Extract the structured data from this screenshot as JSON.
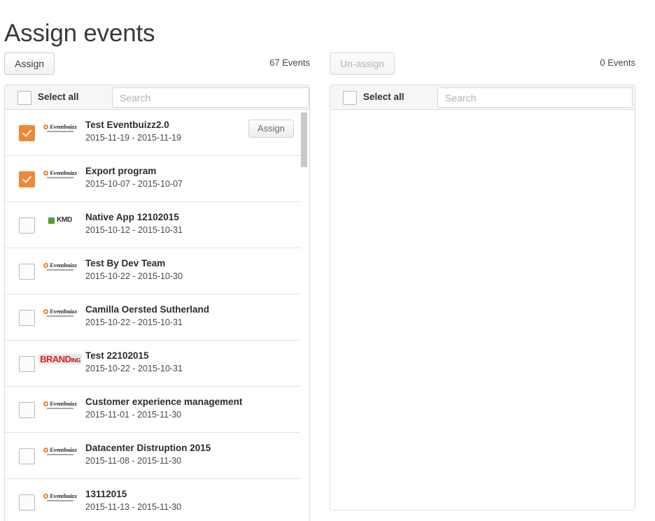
{
  "page": {
    "title": "Assign events"
  },
  "left_panel": {
    "action_button": "Assign",
    "action_disabled": false,
    "count_label": "67 Events",
    "select_all_label": "Select all",
    "search_placeholder": "Search",
    "search_value": "",
    "rows": [
      {
        "checked": true,
        "logo": "eventbuizz-logo",
        "title": "Test Eventbuizz2.0",
        "dates": "2015-11-19 - 2015-11-19",
        "action": "Assign",
        "show_action": true
      },
      {
        "checked": true,
        "logo": "eventbuizz-logo",
        "title": "Export program",
        "dates": "2015-10-07 - 2015-10-07",
        "action": "Assign",
        "show_action": false
      },
      {
        "checked": false,
        "logo": "kmd-logo",
        "title": "Native App 12102015",
        "dates": "2015-10-12 - 2015-10-31",
        "action": "Assign",
        "show_action": false
      },
      {
        "checked": false,
        "logo": "eventbuizz-logo",
        "title": "Test By Dev Team",
        "dates": "2015-10-22 - 2015-10-30",
        "action": "Assign",
        "show_action": false
      },
      {
        "checked": false,
        "logo": "eventbuizz-logo",
        "title": "Camilla Oersted Sutherland",
        "dates": "2015-10-22 - 2015-10-31",
        "action": "Assign",
        "show_action": false
      },
      {
        "checked": false,
        "logo": "branding-logo",
        "title": "Test 22102015",
        "dates": "2015-10-22 - 2015-10-31",
        "action": "Assign",
        "show_action": false
      },
      {
        "checked": false,
        "logo": "eventbuizz-logo",
        "title": "Customer experience management",
        "dates": "2015-11-01 - 2015-11-30",
        "action": "Assign",
        "show_action": false
      },
      {
        "checked": false,
        "logo": "eventbuizz-logo",
        "title": "Datacenter Distruption 2015",
        "dates": "2015-11-08 - 2015-11-30",
        "action": "Assign",
        "show_action": false
      },
      {
        "checked": false,
        "logo": "eventbuizz-logo",
        "title": "13112015",
        "dates": "2015-11-13 - 2015-11-30",
        "action": "Assign",
        "show_action": false
      }
    ]
  },
  "right_panel": {
    "action_button": "Un-assign",
    "action_disabled": true,
    "count_label": "0 Events",
    "select_all_label": "Select all",
    "search_placeholder": "Search",
    "search_value": "",
    "rows": []
  },
  "colors": {
    "accent": "#ef8735",
    "panel_border": "#dcdcdc",
    "head_background": "#f6f6f6",
    "kmd_green": "#4aa32e",
    "branding_red": "#d8221f"
  }
}
